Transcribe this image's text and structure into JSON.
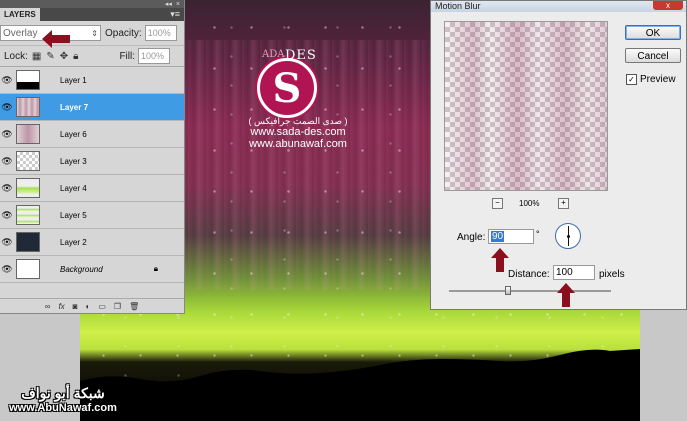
{
  "layers_panel": {
    "tab_label": "LAYERS",
    "collapse_glyph": "◂◂",
    "close_glyph": "×",
    "menu_glyph": "▾≡",
    "blend_mode": "Overlay",
    "blend_chevron": "⇕",
    "opacity_label": "Opacity:",
    "opacity_value": "100%",
    "lock_label": "Lock:",
    "fill_label": "Fill:",
    "fill_value": "100%",
    "layers": [
      {
        "name": "Layer 1",
        "selected": false
      },
      {
        "name": "Layer 7",
        "selected": true
      },
      {
        "name": "Layer 6",
        "selected": false
      },
      {
        "name": "Layer 3",
        "selected": false
      },
      {
        "name": "Layer 4",
        "selected": false
      },
      {
        "name": "Layer 5",
        "selected": false
      },
      {
        "name": "Layer 2",
        "selected": false
      },
      {
        "name": "Background",
        "selected": false
      }
    ],
    "bottom_icons": [
      "link-icon",
      "fx-icon",
      "mask-icon",
      "adjustment-icon",
      "folder-icon",
      "new-layer-icon",
      "trash-icon"
    ]
  },
  "dialog": {
    "title": "Motion Blur",
    "close_glyph": "x",
    "ok_label": "OK",
    "cancel_label": "Cancel",
    "preview_label": "Preview",
    "preview_checked": true,
    "zoom_out": "−",
    "zoom_in": "+",
    "zoom_value": "100%",
    "angle_label": "Angle:",
    "angle_value": "90",
    "degree_symbol": "°",
    "distance_label": "Distance:",
    "distance_value": "100",
    "pixels_label": "pixels"
  },
  "watermark": {
    "logo_letter": "S",
    "logo_des": "DES",
    "logo_ada": "ADA",
    "arabic_line": "( صدى الصمت جرافيكس )",
    "site1": "www.sada-des.com",
    "site2": "www.abunawaf.com"
  },
  "corner_watermark": {
    "arabic": "شبكة أبو نواف",
    "site": "www.AbuNawaf.com"
  },
  "colors": {
    "arrow_red": "#8a0f1f",
    "selection_blue": "#3f9be3",
    "logo_magenta": "#b01452"
  }
}
